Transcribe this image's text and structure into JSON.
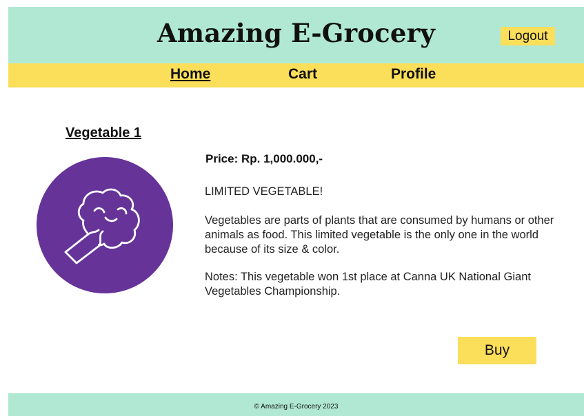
{
  "header": {
    "brand": "Amazing E-Grocery",
    "logout_label": "Logout"
  },
  "nav": {
    "items": [
      {
        "label": "Home",
        "active": true
      },
      {
        "label": "Cart",
        "active": false
      },
      {
        "label": "Profile",
        "active": false
      }
    ]
  },
  "product": {
    "name": "Vegetable 1",
    "image_icon": "broccoli-icon",
    "price": "Price: Rp. 1,000.000,-",
    "tagline": "LIMITED VEGETABLE!",
    "description": "Vegetables are parts of plants that are consumed by humans or other animals as food. This limited vegetable is the only one in the world because of its size & color.",
    "notes": "Notes: This vegetable won 1st place at Canna UK National Giant Vegetables Championship.",
    "buy_label": "Buy"
  },
  "footer": {
    "copyright": "© Amazing E-Grocery 2023"
  },
  "colors": {
    "mint": "#b0e8d3",
    "yellow": "#fbde59",
    "purple": "#663399"
  }
}
